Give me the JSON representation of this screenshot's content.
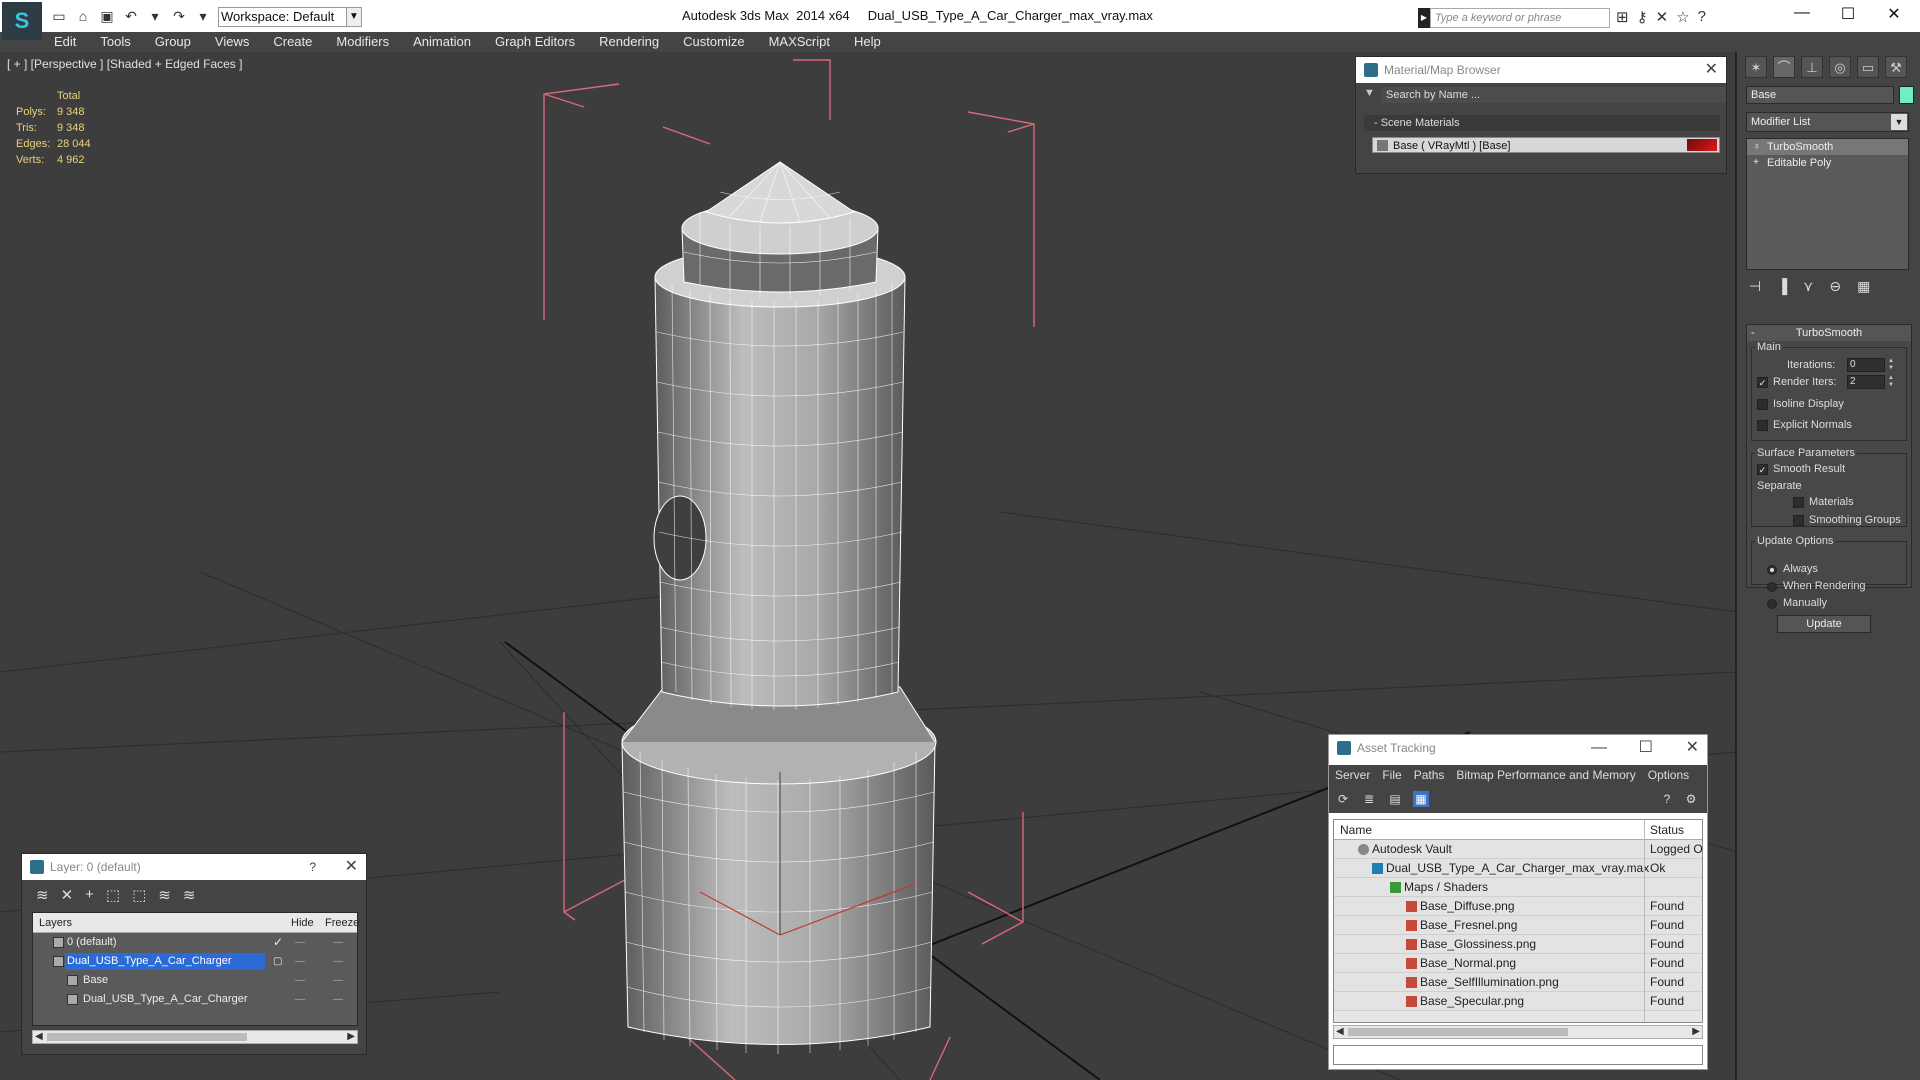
{
  "titlebar": {
    "workspace_label": "Workspace: Default",
    "app_title": "Autodesk 3ds Max  2014 x64     Dual_USB_Type_A_Car_Charger_max_vray.max",
    "search_placeholder": "Type a keyword or phrase",
    "minimize": "—",
    "maximize": "☐",
    "close": "✕"
  },
  "menu": [
    "Edit",
    "Tools",
    "Group",
    "Views",
    "Create",
    "Modifiers",
    "Animation",
    "Graph Editors",
    "Rendering",
    "Customize",
    "MAXScript",
    "Help"
  ],
  "viewport": {
    "label": "[ + ] [Perspective ] [Shaded + Edged Faces ]",
    "stats": {
      "total_label": "Total",
      "rows": [
        {
          "key": "Polys:",
          "value": "9 348"
        },
        {
          "key": "Tris:",
          "value": "9 348"
        },
        {
          "key": "Edges:",
          "value": "28 044"
        },
        {
          "key": "Verts:",
          "value": "4 962"
        }
      ]
    },
    "background_color": "#3d3d3d",
    "bbox_color": "#d9687a",
    "wire_color": "#ffffff"
  },
  "material_browser": {
    "title": "Material/Map Browser",
    "search_placeholder": "Search by Name ...",
    "section_label": "- Scene Materials",
    "material_row": "Base  ( VRayMtl )  [Base]"
  },
  "command_panel": {
    "object_name": "Base",
    "object_color": "#6cf0c0",
    "modifier_list_label": "Modifier List",
    "stack": [
      "TurboSmooth",
      "Editable Poly"
    ],
    "rollout_title": "TurboSmooth",
    "main_group": "Main",
    "iterations_label": "Iterations:",
    "iterations_value": "0",
    "render_iters_label": "Render Iters:",
    "render_iters_value": "2",
    "isoline_label": "Isoline Display",
    "explicit_normals_label": "Explicit Normals",
    "surface_group": "Surface Parameters",
    "smooth_result_label": "Smooth Result",
    "separate_label": "Separate",
    "materials_label": "Materials",
    "smoothing_groups_label": "Smoothing Groups",
    "update_group": "Update Options",
    "always_label": "Always",
    "when_rendering_label": "When Rendering",
    "manually_label": "Manually",
    "update_button": "Update"
  },
  "layer_panel": {
    "title": "Layer: 0 (default)",
    "help": "?",
    "close": "✕",
    "col_layers": "Layers",
    "col_hide": "Hide",
    "col_freeze": "Freeze",
    "rows": [
      {
        "name": "0 (default)",
        "indent": 0,
        "checked": true,
        "selected": false
      },
      {
        "name": "Dual_USB_Type_A_Car_Charger",
        "indent": 0,
        "checked": false,
        "selected": true
      },
      {
        "name": "Base",
        "indent": 1,
        "checked": false,
        "selected": false
      },
      {
        "name": "Dual_USB_Type_A_Car_Charger",
        "indent": 1,
        "checked": false,
        "selected": false
      }
    ]
  },
  "asset_tracking": {
    "title": "Asset Tracking",
    "menu": [
      "Server",
      "File",
      "Paths",
      "Bitmap Performance and Memory",
      "Options"
    ],
    "col_name": "Name",
    "col_status": "Status",
    "rows": [
      {
        "name": "Autodesk Vault",
        "status": "Logged Ou",
        "indent": 1
      },
      {
        "name": "Dual_USB_Type_A_Car_Charger_max_vray.max",
        "status": "Ok",
        "indent": 2
      },
      {
        "name": "Maps / Shaders",
        "status": "",
        "indent": 3
      },
      {
        "name": "Base_Diffuse.png",
        "status": "Found",
        "indent": 4
      },
      {
        "name": "Base_Fresnel.png",
        "status": "Found",
        "indent": 4
      },
      {
        "name": "Base_Glossiness.png",
        "status": "Found",
        "indent": 4
      },
      {
        "name": "Base_Normal.png",
        "status": "Found",
        "indent": 4
      },
      {
        "name": "Base_SelfIllumination.png",
        "status": "Found",
        "indent": 4
      },
      {
        "name": "Base_Specular.png",
        "status": "Found",
        "indent": 4
      }
    ]
  }
}
